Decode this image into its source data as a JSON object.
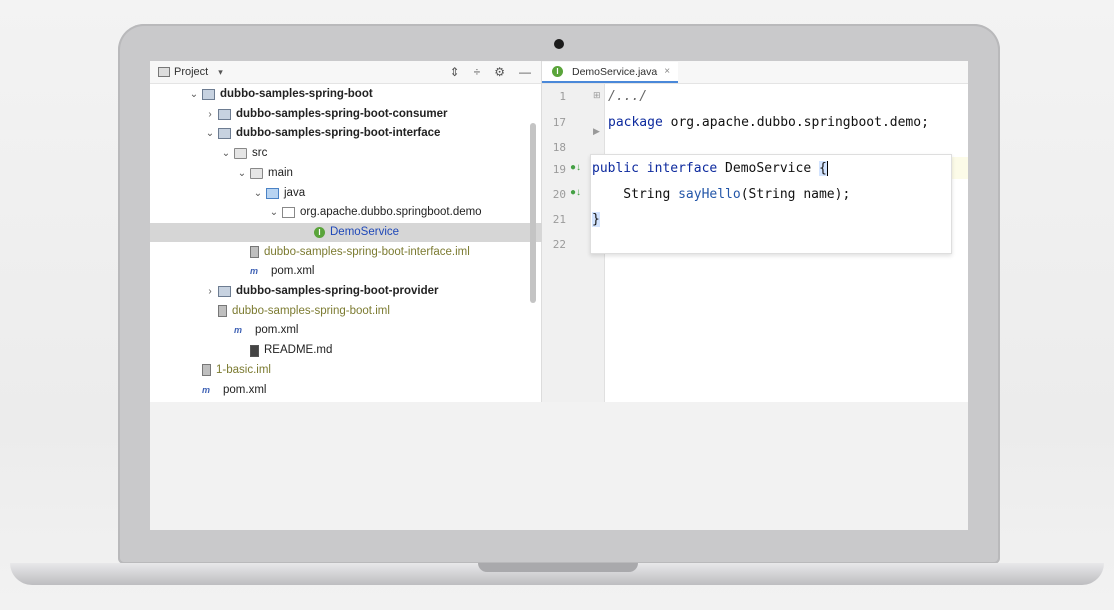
{
  "project_panel": {
    "title": "Project",
    "tree": [
      {
        "label": "dubbo-samples-spring-boot",
        "style": "bold",
        "icon": "module-folder-icon",
        "arrow": "⌄"
      },
      {
        "label": "dubbo-samples-spring-boot-consumer",
        "style": "bold",
        "icon": "module-folder-icon",
        "arrow": "›"
      },
      {
        "label": "dubbo-samples-spring-boot-interface",
        "style": "bold",
        "icon": "module-folder-icon",
        "arrow": "⌄"
      },
      {
        "label": "src",
        "style": "normal",
        "icon": "folder-icon",
        "arrow": "⌄"
      },
      {
        "label": "main",
        "style": "normal",
        "icon": "folder-icon",
        "arrow": "⌄"
      },
      {
        "label": "java",
        "style": "normal",
        "icon": "source-folder-icon",
        "arrow": "⌄"
      },
      {
        "label": "org.apache.dubbo.springboot.demo",
        "style": "normal",
        "icon": "package-icon",
        "arrow": "⌄"
      },
      {
        "label": "DemoService",
        "style": "blue",
        "icon": "interface-icon",
        "arrow": ""
      },
      {
        "label": "dubbo-samples-spring-boot-interface.iml",
        "style": "iml",
        "icon": "iml-file-icon",
        "arrow": ""
      },
      {
        "label": "pom.xml",
        "style": "normal",
        "icon": "maven-icon",
        "arrow": ""
      },
      {
        "label": "dubbo-samples-spring-boot-provider",
        "style": "bold",
        "icon": "module-folder-icon",
        "arrow": "›"
      },
      {
        "label": "dubbo-samples-spring-boot.iml",
        "style": "iml",
        "icon": "iml-file-icon",
        "arrow": ""
      },
      {
        "label": "pom.xml",
        "style": "normal",
        "icon": "maven-icon",
        "arrow": ""
      },
      {
        "label": "README.md",
        "style": "normal",
        "icon": "markdown-icon",
        "arrow": ""
      },
      {
        "label": "1-basic.iml",
        "style": "iml",
        "icon": "iml-file-icon",
        "arrow": ""
      },
      {
        "label": "pom.xml",
        "style": "normal",
        "icon": "maven-icon",
        "arrow": ""
      }
    ]
  },
  "editor": {
    "tab_label": "DemoService.java",
    "tab_icon_letter": "I",
    "interface_icon_letter": "I",
    "lines": [
      {
        "num": "1",
        "text": "/.../"
      },
      {
        "num": "17",
        "kw": "package",
        "text": " org.apache.dubbo.springboot.demo;"
      },
      {
        "num": "18",
        "text": ""
      },
      {
        "num": "19",
        "kw": "public interface",
        "text": " DemoService ",
        "brace": "{"
      },
      {
        "num": "20",
        "text": "    String ",
        "fn": "sayHello",
        "rest": "(String name);"
      },
      {
        "num": "21",
        "text": "}"
      },
      {
        "num": "22",
        "text": ""
      }
    ]
  }
}
